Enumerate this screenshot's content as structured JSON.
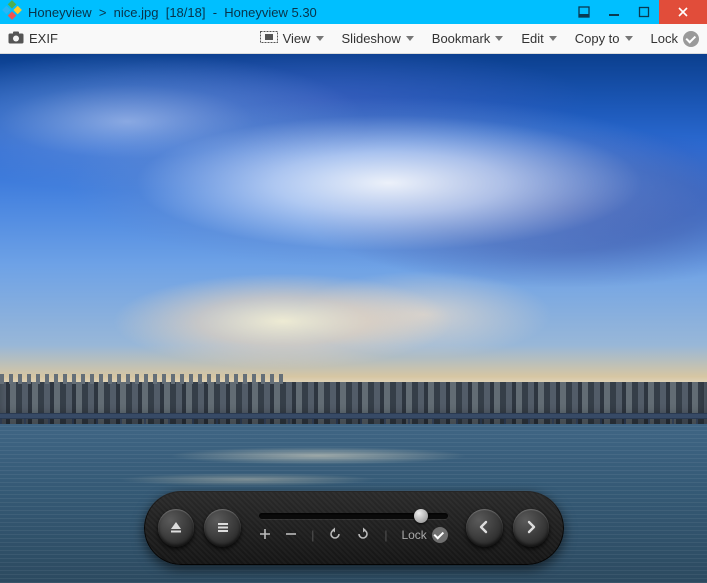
{
  "title": {
    "app": "Honeyview",
    "sep": ">",
    "file": "nice.jpg",
    "index": "[18/18]",
    "dash": "-",
    "appver": "Honeyview 5.30"
  },
  "toolbar": {
    "exif_label": "EXIF",
    "view_label": "View",
    "slideshow_label": "Slideshow",
    "bookmark_label": "Bookmark",
    "edit_label": "Edit",
    "copyto_label": "Copy to",
    "lock_label": "Lock"
  },
  "player": {
    "slider_value_pct": 86,
    "lock_label": "Lock"
  },
  "colors": {
    "titlebar": "#00BFFF",
    "close": "#E14D3A"
  }
}
